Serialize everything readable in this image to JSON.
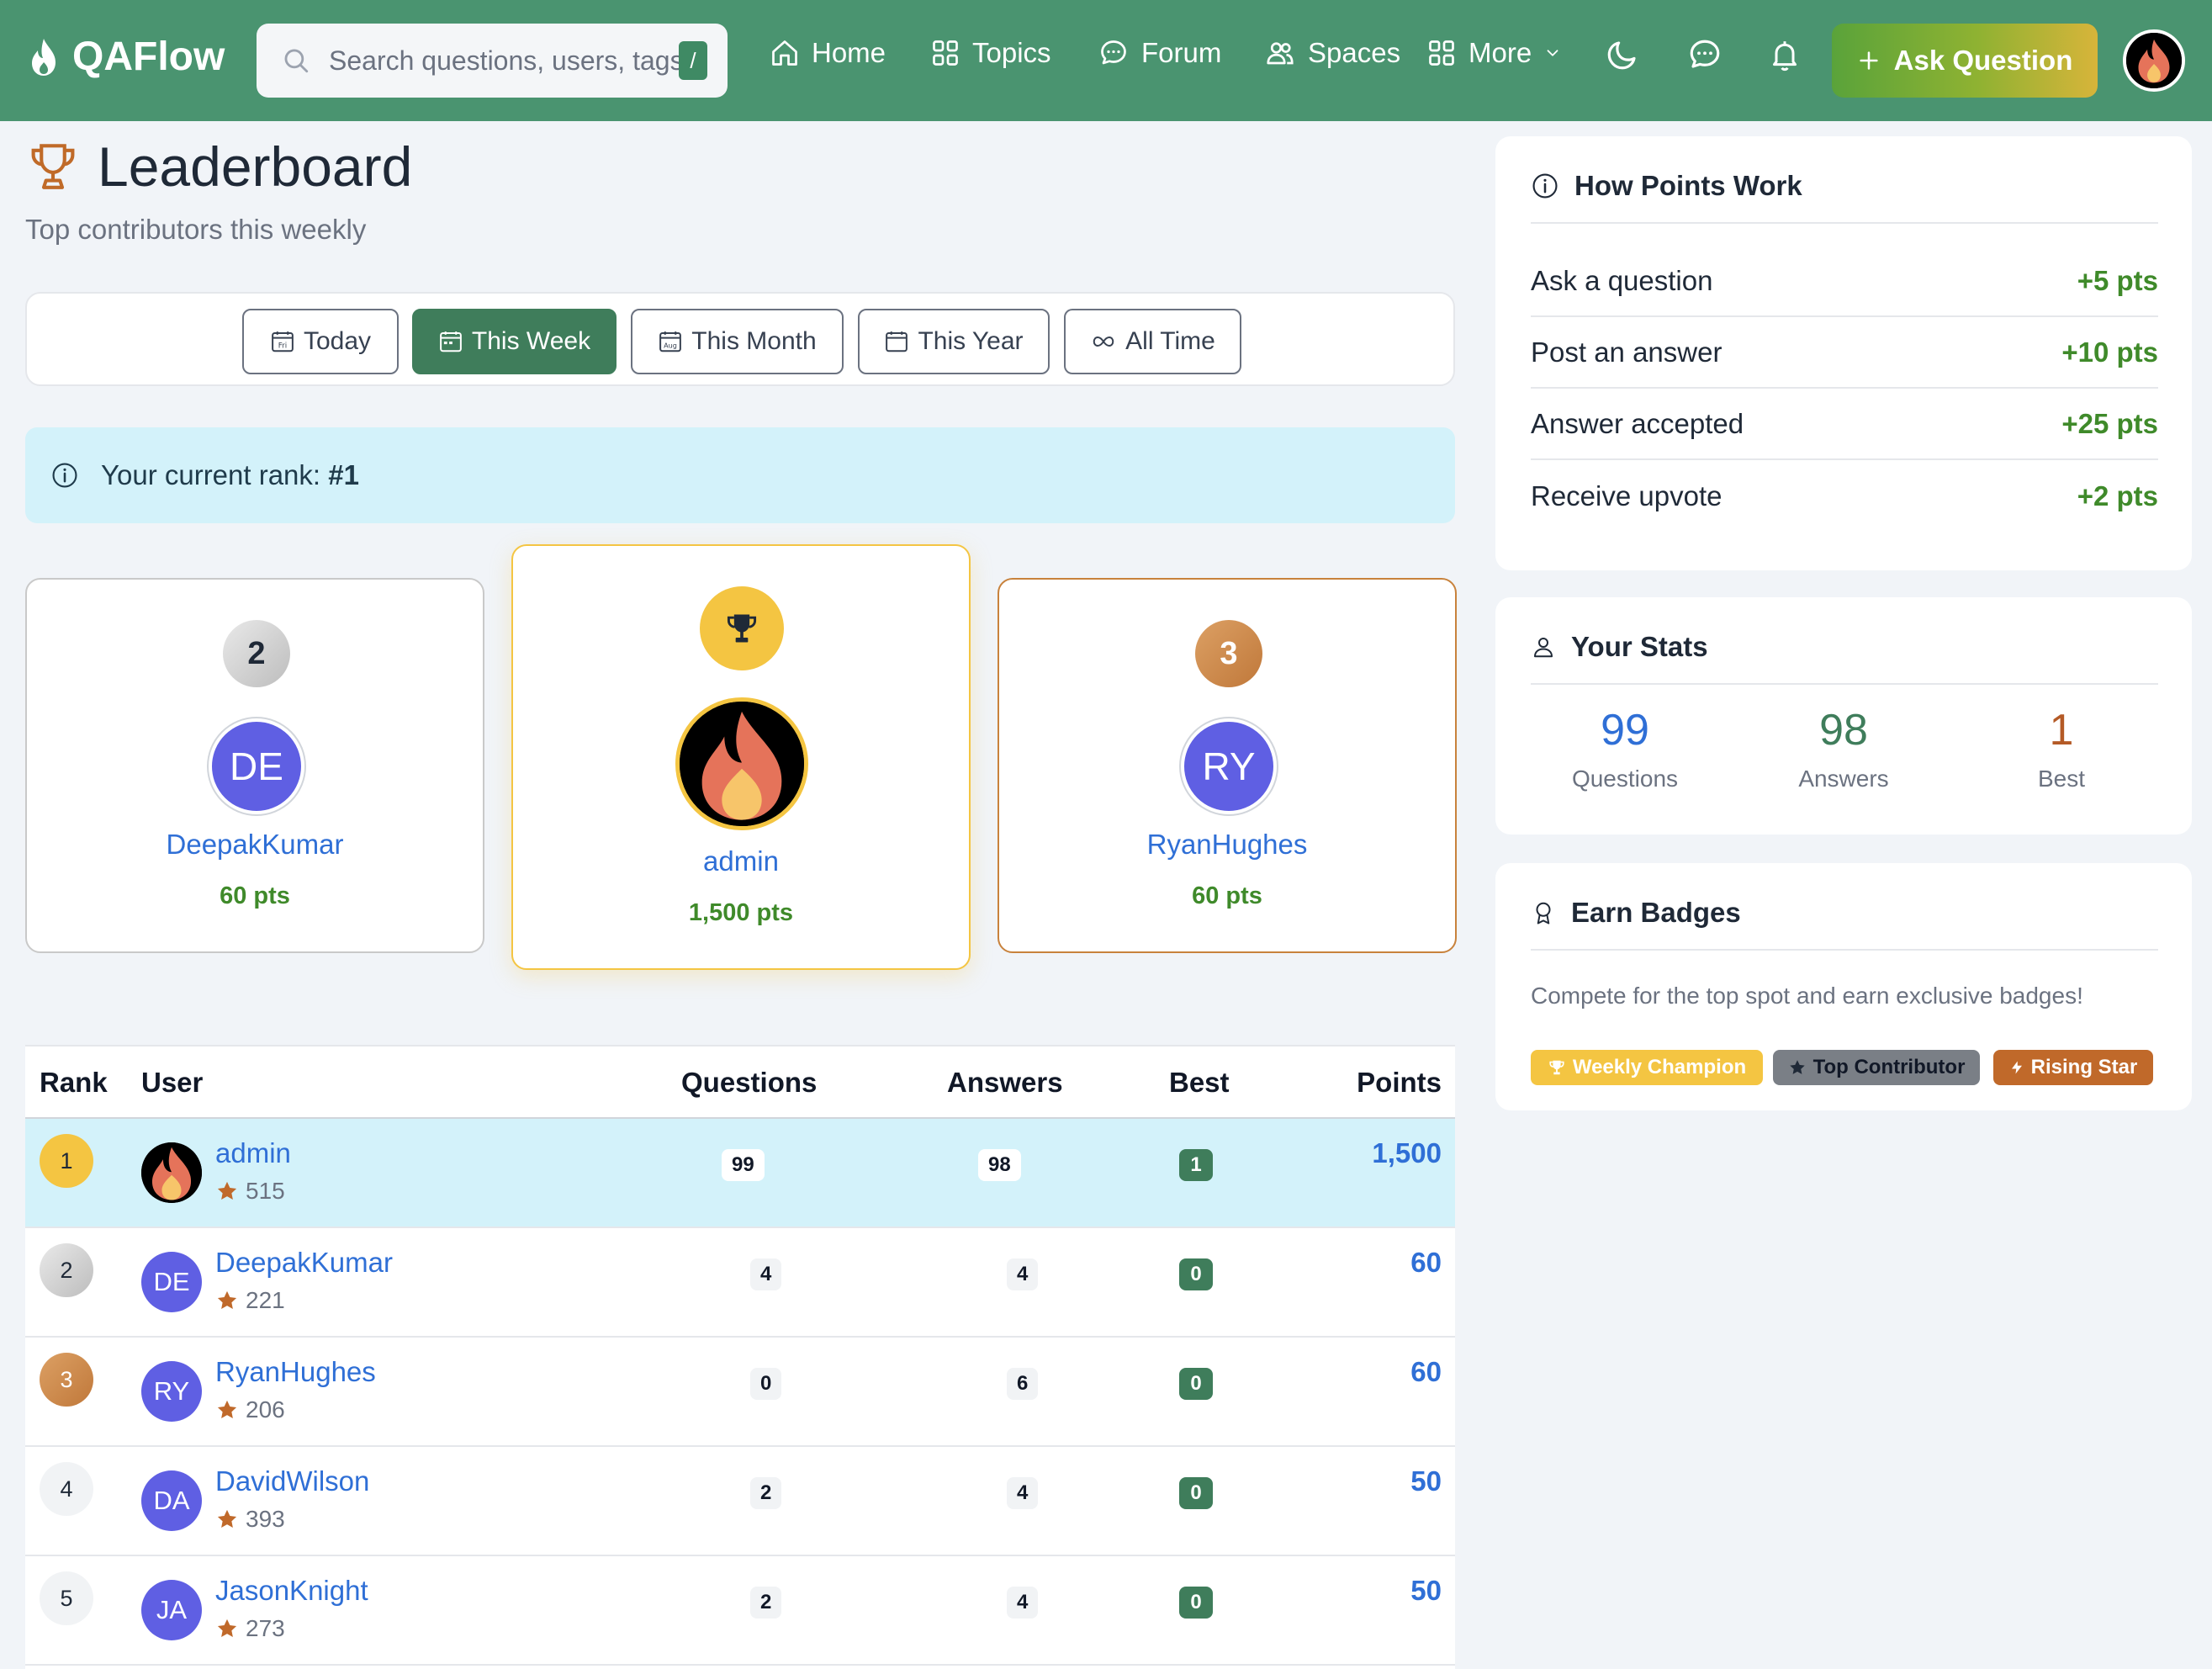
{
  "brand": {
    "name": "QAFlow"
  },
  "search": {
    "placeholder": "Search questions, users, tags",
    "shortcut": "/"
  },
  "nav": {
    "home": "Home",
    "topics": "Topics",
    "forum": "Forum",
    "spaces": "Spaces",
    "more": "More",
    "ask": "Ask Question"
  },
  "page": {
    "title": "Leaderboard",
    "subtitle": "Top contributors this weekly"
  },
  "filters": {
    "today": "Today",
    "week": "This Week",
    "month": "This Month",
    "year": "This Year",
    "all": "All Time",
    "active": "This Week",
    "today_badge": "Fri",
    "month_badge": "Aug"
  },
  "alert": {
    "text": "Your current rank:",
    "rank": "#1"
  },
  "podium": {
    "first": {
      "rank": "1",
      "name": "admin",
      "points": "1,500 pts"
    },
    "second": {
      "rank": "2",
      "initials": "DE",
      "name": "DeepakKumar",
      "points": "60 pts"
    },
    "third": {
      "rank": "3",
      "initials": "RY",
      "name": "RyanHughes",
      "points": "60 pts"
    }
  },
  "table": {
    "headers": {
      "rank": "Rank",
      "user": "User",
      "questions": "Questions",
      "answers": "Answers",
      "best": "Best",
      "points": "Points"
    },
    "rows": [
      {
        "rank": "1",
        "name": "admin",
        "initials": "",
        "rep": "515",
        "questions": "99",
        "answers": "98",
        "best": "1",
        "points": "1,500"
      },
      {
        "rank": "2",
        "name": "DeepakKumar",
        "initials": "DE",
        "rep": "221",
        "questions": "4",
        "answers": "4",
        "best": "0",
        "points": "60"
      },
      {
        "rank": "3",
        "name": "RyanHughes",
        "initials": "RY",
        "rep": "206",
        "questions": "0",
        "answers": "6",
        "best": "0",
        "points": "60"
      },
      {
        "rank": "4",
        "name": "DavidWilson",
        "initials": "DA",
        "rep": "393",
        "questions": "2",
        "answers": "4",
        "best": "0",
        "points": "50"
      },
      {
        "rank": "5",
        "name": "JasonKnight",
        "initials": "JA",
        "rep": "273",
        "questions": "2",
        "answers": "4",
        "best": "0",
        "points": "50"
      }
    ]
  },
  "points_card": {
    "title": "How Points Work",
    "items": [
      {
        "label": "Ask a question",
        "value": "+5 pts"
      },
      {
        "label": "Post an answer",
        "value": "+10 pts"
      },
      {
        "label": "Answer accepted",
        "value": "+25 pts"
      },
      {
        "label": "Receive upvote",
        "value": "+2 pts"
      }
    ]
  },
  "stats_card": {
    "title": "Your Stats",
    "questions": {
      "value": "99",
      "label": "Questions"
    },
    "answers": {
      "value": "98",
      "label": "Answers"
    },
    "best": {
      "value": "1",
      "label": "Best"
    }
  },
  "badges_card": {
    "title": "Earn Badges",
    "text": "Compete for the top spot and earn exclusive badges!",
    "badges": [
      {
        "label": "Weekly Champion"
      },
      {
        "label": "Top Contributor"
      },
      {
        "label": "Rising Star"
      }
    ]
  },
  "colors": {
    "navbar": "#4a9470",
    "accent_green": "#3f7d5b",
    "link_blue": "#2f6fd6",
    "points_green": "#3f8a2a",
    "gold": "#f4c542",
    "bronze": "#c8823c",
    "silver": "#d1d1d1",
    "alert_bg": "#d3f2fa"
  }
}
